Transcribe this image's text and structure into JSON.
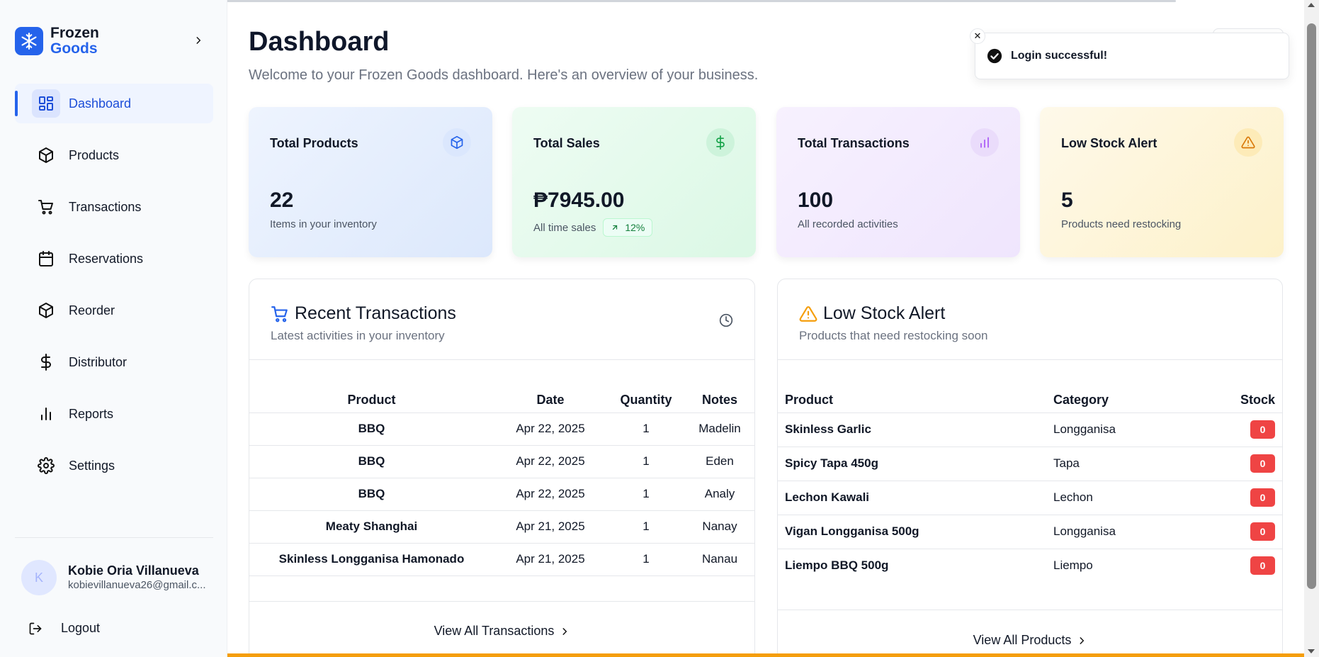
{
  "brand": {
    "line1": "Frozen",
    "line2": "Goods"
  },
  "sidebar": {
    "items": [
      {
        "label": "Dashboard",
        "icon": "dashboard-icon",
        "active": true
      },
      {
        "label": "Products",
        "icon": "box-icon"
      },
      {
        "label": "Transactions",
        "icon": "cart-icon"
      },
      {
        "label": "Reservations",
        "icon": "calendar-icon"
      },
      {
        "label": "Reorder",
        "icon": "box-icon"
      },
      {
        "label": "Distributor",
        "icon": "dollar-icon"
      },
      {
        "label": "Reports",
        "icon": "bar-chart-icon"
      },
      {
        "label": "Settings",
        "icon": "gear-icon"
      }
    ],
    "user": {
      "initial": "K",
      "name": "Kobie Oria Villanueva",
      "email": "kobievillanueva26@gmail.c..."
    },
    "logout": "Logout"
  },
  "header": {
    "title": "Dashboard",
    "subtitle": "Welcome to your Frozen Goods dashboard. Here's an overview of your business."
  },
  "stats": [
    {
      "title": "Total Products",
      "value": "22",
      "desc": "Items in your inventory",
      "icon": "box-icon",
      "color": "#2563eb"
    },
    {
      "title": "Total Sales",
      "value": "₱7945.00",
      "desc": "All time sales",
      "trend": "12%",
      "icon": "dollar-icon",
      "color": "#16a34a"
    },
    {
      "title": "Total Transactions",
      "value": "100",
      "desc": "All recorded activities",
      "icon": "bar-chart-icon",
      "color": "#a855f7"
    },
    {
      "title": "Low Stock Alert",
      "value": "5",
      "desc": "Products need restocking",
      "icon": "alert-triangle-icon",
      "color": "#d97706"
    }
  ],
  "recent": {
    "title": "Recent Transactions",
    "subtitle": "Latest activities in your inventory",
    "columns": [
      "Product",
      "Date",
      "Quantity",
      "Notes"
    ],
    "rows": [
      [
        "BBQ",
        "Apr 22, 2025",
        "1",
        "Madelin"
      ],
      [
        "BBQ",
        "Apr 22, 2025",
        "1",
        "Eden"
      ],
      [
        "BBQ",
        "Apr 22, 2025",
        "1",
        "Analy"
      ],
      [
        "Meaty Shanghai",
        "Apr 21, 2025",
        "1",
        "Nanay"
      ],
      [
        "Skinless Longganisa Hamonado",
        "Apr 21, 2025",
        "1",
        "Nanau"
      ]
    ],
    "view_all": "View All Transactions"
  },
  "lowstock": {
    "title": "Low Stock Alert",
    "subtitle": "Products that need restocking soon",
    "columns": [
      "Product",
      "Category",
      "Stock"
    ],
    "rows": [
      [
        "Skinless Garlic",
        "Longganisa",
        "0"
      ],
      [
        "Spicy Tapa 450g",
        "Tapa",
        "0"
      ],
      [
        "Lechon Kawali",
        "Lechon",
        "0"
      ],
      [
        "Vigan Longganisa 500g",
        "Longganisa",
        "0"
      ],
      [
        "Liempo BBQ 500g",
        "Liempo",
        "0"
      ]
    ],
    "view_all": "View All Products"
  },
  "toast": {
    "message": "Login successful!",
    "close": "✕"
  },
  "colors": {
    "accent": "#2563eb",
    "danger": "#ef4444",
    "warning": "#f59e0b",
    "success": "#16a34a"
  }
}
